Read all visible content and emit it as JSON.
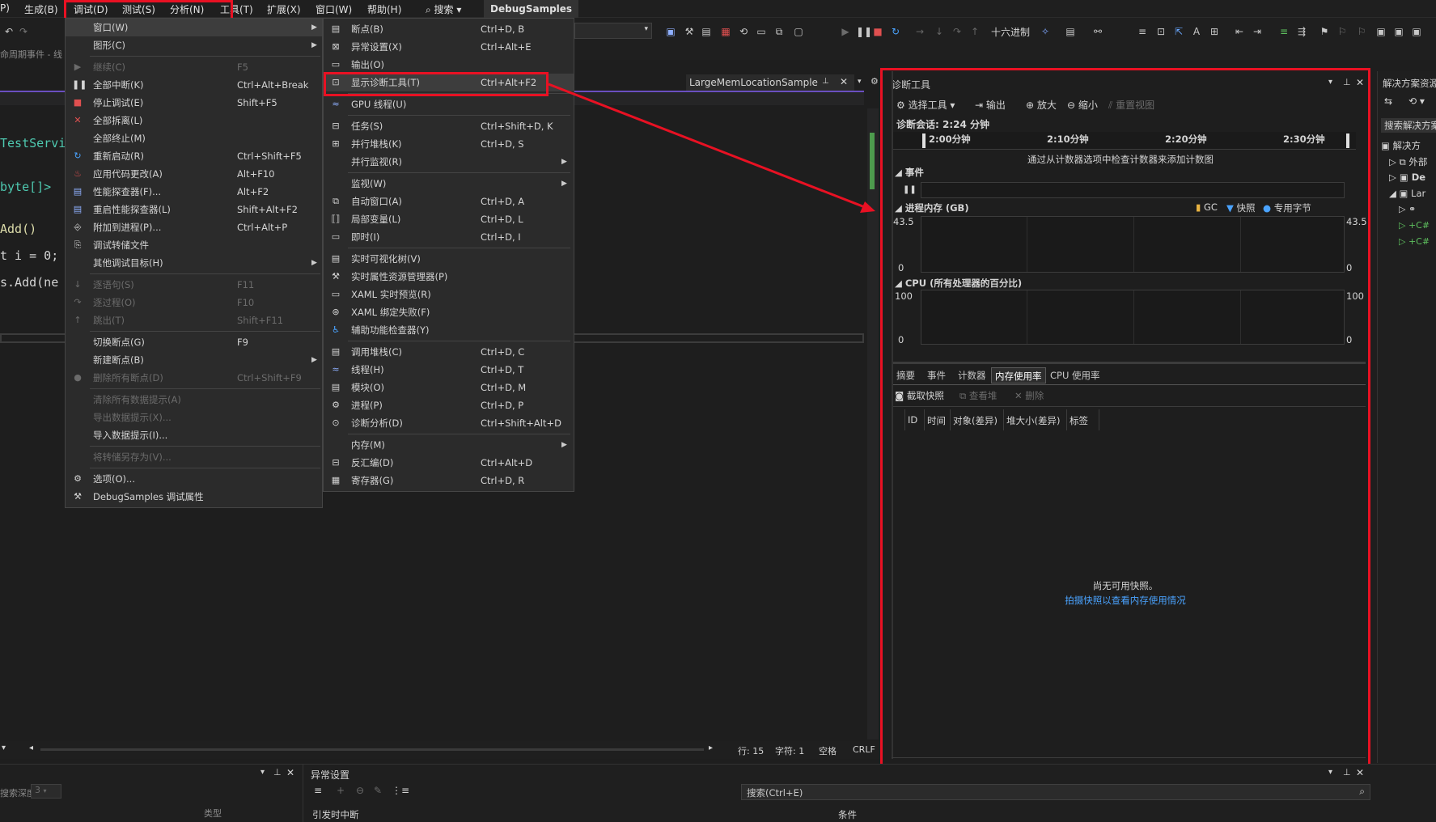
{
  "menubar": {
    "items": [
      "P)",
      "生成(B)",
      "调试(D)",
      "测试(S)",
      "分析(N)",
      "工具(T)",
      "扩展(X)",
      "窗口(W)",
      "帮助(H)"
    ],
    "search": "搜索",
    "solution": "DebugSamples"
  },
  "toolbar": {
    "hex_label": "十六进制"
  },
  "row3": {
    "text": "命周期事件 - 线"
  },
  "editor": {
    "tab_label": "LargeMemLocationSample",
    "lines": [
      "TestServi",
      "byte[]>",
      "Add()",
      "t i = 0;",
      "s.Add(ne"
    ]
  },
  "debug_menu": {
    "items": [
      {
        "label": "窗口(W)",
        "shortcut": "",
        "submenu": true,
        "disabled": false,
        "icon": ""
      },
      {
        "label": "图形(C)",
        "shortcut": "",
        "submenu": true,
        "disabled": false,
        "icon": ""
      },
      {
        "label": "继续(C)",
        "shortcut": "F5",
        "submenu": false,
        "disabled": true,
        "icon": "play-icon"
      },
      {
        "label": "全部中断(K)",
        "shortcut": "Ctrl+Alt+Break",
        "submenu": false,
        "disabled": false,
        "icon": "pause-icon"
      },
      {
        "label": "停止调试(E)",
        "shortcut": "Shift+F5",
        "submenu": false,
        "disabled": false,
        "icon": "stop-icon"
      },
      {
        "label": "全部拆离(L)",
        "shortcut": "",
        "submenu": false,
        "disabled": false,
        "icon": "detach-icon"
      },
      {
        "label": "全部终止(M)",
        "shortcut": "",
        "submenu": false,
        "disabled": false,
        "icon": ""
      },
      {
        "label": "重新启动(R)",
        "shortcut": "Ctrl+Shift+F5",
        "submenu": false,
        "disabled": false,
        "icon": "restart-icon"
      },
      {
        "label": "应用代码更改(A)",
        "shortcut": "Alt+F10",
        "submenu": false,
        "disabled": false,
        "icon": "hot-reload-icon"
      },
      {
        "label": "性能探查器(F)...",
        "shortcut": "Alt+F2",
        "submenu": false,
        "disabled": false,
        "icon": "profiler-icon"
      },
      {
        "label": "重启性能探查器(L)",
        "shortcut": "Shift+Alt+F2",
        "submenu": false,
        "disabled": false,
        "icon": "profiler-restart-icon"
      },
      {
        "label": "附加到进程(P)...",
        "shortcut": "Ctrl+Alt+P",
        "submenu": false,
        "disabled": false,
        "icon": "attach-icon"
      },
      {
        "label": "调试转储文件",
        "shortcut": "",
        "submenu": false,
        "disabled": false,
        "icon": "dump-icon"
      },
      {
        "label": "其他调试目标(H)",
        "shortcut": "",
        "submenu": true,
        "disabled": false,
        "icon": ""
      },
      {
        "label": "逐语句(S)",
        "shortcut": "F11",
        "submenu": false,
        "disabled": true,
        "icon": "step-into-icon"
      },
      {
        "label": "逐过程(O)",
        "shortcut": "F10",
        "submenu": false,
        "disabled": true,
        "icon": "step-over-icon"
      },
      {
        "label": "跳出(T)",
        "shortcut": "Shift+F11",
        "submenu": false,
        "disabled": true,
        "icon": "step-out-icon"
      },
      {
        "label": "切换断点(G)",
        "shortcut": "F9",
        "submenu": false,
        "disabled": false,
        "icon": ""
      },
      {
        "label": "新建断点(B)",
        "shortcut": "",
        "submenu": true,
        "disabled": false,
        "icon": ""
      },
      {
        "label": "删除所有断点(D)",
        "shortcut": "Ctrl+Shift+F9",
        "submenu": false,
        "disabled": true,
        "icon": "delete-breakpoints-icon"
      },
      {
        "label": "清除所有数据提示(A)",
        "shortcut": "",
        "submenu": false,
        "disabled": true,
        "icon": ""
      },
      {
        "label": "导出数据提示(X)...",
        "shortcut": "",
        "submenu": false,
        "disabled": true,
        "icon": ""
      },
      {
        "label": "导入数据提示(I)...",
        "shortcut": "",
        "submenu": false,
        "disabled": false,
        "icon": ""
      },
      {
        "label": "将转储另存为(V)...",
        "shortcut": "",
        "submenu": false,
        "disabled": true,
        "icon": ""
      },
      {
        "label": "选项(O)...",
        "shortcut": "",
        "submenu": false,
        "disabled": false,
        "icon": "gear-icon"
      },
      {
        "label": "DebugSamples 调试属性",
        "shortcut": "",
        "submenu": false,
        "disabled": false,
        "icon": "wrench-icon"
      }
    ]
  },
  "window_menu": {
    "items": [
      {
        "label": "断点(B)",
        "shortcut": "Ctrl+D, B",
        "submenu": false,
        "icon": "breakpoints-icon"
      },
      {
        "label": "异常设置(X)",
        "shortcut": "Ctrl+Alt+E",
        "submenu": false,
        "icon": "exception-icon"
      },
      {
        "label": "输出(O)",
        "shortcut": "",
        "submenu": false,
        "icon": "output-icon"
      },
      {
        "label": "显示诊断工具(T)",
        "shortcut": "Ctrl+Alt+F2",
        "submenu": false,
        "icon": "diagnostics-icon"
      },
      {
        "label": "GPU 线程(U)",
        "shortcut": "",
        "submenu": false,
        "icon": "gpu-threads-icon"
      },
      {
        "label": "任务(S)",
        "shortcut": "Ctrl+Shift+D, K",
        "submenu": false,
        "icon": "tasks-icon"
      },
      {
        "label": "并行堆栈(K)",
        "shortcut": "Ctrl+D, S",
        "submenu": false,
        "icon": "parallel-stacks-icon"
      },
      {
        "label": "并行监视(R)",
        "shortcut": "",
        "submenu": true,
        "icon": ""
      },
      {
        "label": "监视(W)",
        "shortcut": "",
        "submenu": true,
        "icon": ""
      },
      {
        "label": "自动窗口(A)",
        "shortcut": "Ctrl+D, A",
        "submenu": false,
        "icon": "autos-icon"
      },
      {
        "label": "局部变量(L)",
        "shortcut": "Ctrl+D, L",
        "submenu": false,
        "icon": "locals-icon"
      },
      {
        "label": "即时(I)",
        "shortcut": "Ctrl+D, I",
        "submenu": false,
        "icon": "immediate-icon"
      },
      {
        "label": "实时可视化树(V)",
        "shortcut": "",
        "submenu": false,
        "icon": "visual-tree-icon"
      },
      {
        "label": "实时属性资源管理器(P)",
        "shortcut": "",
        "submenu": false,
        "icon": "property-explorer-icon"
      },
      {
        "label": "XAML 实时预览(R)",
        "shortcut": "",
        "submenu": false,
        "icon": "xaml-preview-icon"
      },
      {
        "label": "XAML 绑定失败(F)",
        "shortcut": "",
        "submenu": false,
        "icon": "xaml-binding-icon"
      },
      {
        "label": "辅助功能检查器(Y)",
        "shortcut": "",
        "submenu": false,
        "icon": "accessibility-icon"
      },
      {
        "label": "调用堆栈(C)",
        "shortcut": "Ctrl+D, C",
        "submenu": false,
        "icon": "call-stack-icon"
      },
      {
        "label": "线程(H)",
        "shortcut": "Ctrl+D, T",
        "submenu": false,
        "icon": "threads-icon"
      },
      {
        "label": "模块(O)",
        "shortcut": "Ctrl+D, M",
        "submenu": false,
        "icon": "modules-icon"
      },
      {
        "label": "进程(P)",
        "shortcut": "Ctrl+D, P",
        "submenu": false,
        "icon": "processes-icon"
      },
      {
        "label": "诊断分析(D)",
        "shortcut": "Ctrl+Shift+Alt+D",
        "submenu": false,
        "icon": "diagnostic-analysis-icon"
      },
      {
        "label": "内存(M)",
        "shortcut": "",
        "submenu": true,
        "icon": ""
      },
      {
        "label": "反汇编(D)",
        "shortcut": "Ctrl+Alt+D",
        "submenu": false,
        "icon": "disassembly-icon"
      },
      {
        "label": "寄存器(G)",
        "shortcut": "Ctrl+D, R",
        "submenu": false,
        "icon": "registers-icon"
      }
    ]
  },
  "diag": {
    "title": "诊断工具",
    "select_tools": "选择工具",
    "output": "输出",
    "zoom_in": "放大",
    "zoom_out": "缩小",
    "reset_view": "重置视图",
    "session": "诊断会话: 2:24 分钟",
    "ticks": [
      "2:00分钟",
      "2:10分钟",
      "2:20分钟",
      "2:30分钟"
    ],
    "hint": "通过从计数器选项中检查计数器来添加计数图",
    "events_label": "事件",
    "mem_label": "进程内存 (GB)",
    "legend": [
      "GC",
      "快照",
      "专用字节"
    ],
    "mem_max": "43.5",
    "mem_min": "0",
    "cpu_label": "CPU (所有处理器的百分比)",
    "cpu_max": "100",
    "cpu_min": "0",
    "tabs": [
      "摘要",
      "事件",
      "计数器",
      "内存使用率",
      "CPU 使用率"
    ],
    "snapshot": "截取快照",
    "view_heap": "查看堆",
    "delete": "删除",
    "columns": [
      "ID",
      "时间",
      "对象(差异)",
      "堆大小(差异)",
      "标签"
    ],
    "empty1": "尚无可用快照。",
    "empty2": "拍摄快照以查看内存使用情况"
  },
  "status": {
    "line": "行: 15",
    "col": "字符: 1",
    "ws": "空格",
    "eol": "CRLF"
  },
  "bottom": {
    "left_label": "搜索深度:",
    "depth": "3",
    "type_col": "类型",
    "exc_title": "异常设置",
    "search_placeholder": "搜索(Ctrl+E)",
    "break_when": "引发时中断",
    "condition": "条件"
  },
  "solution": {
    "title": "解决方案资源",
    "search": "搜索解决方案资",
    "items": [
      "解决方",
      "外部",
      "De",
      "Lar"
    ]
  }
}
